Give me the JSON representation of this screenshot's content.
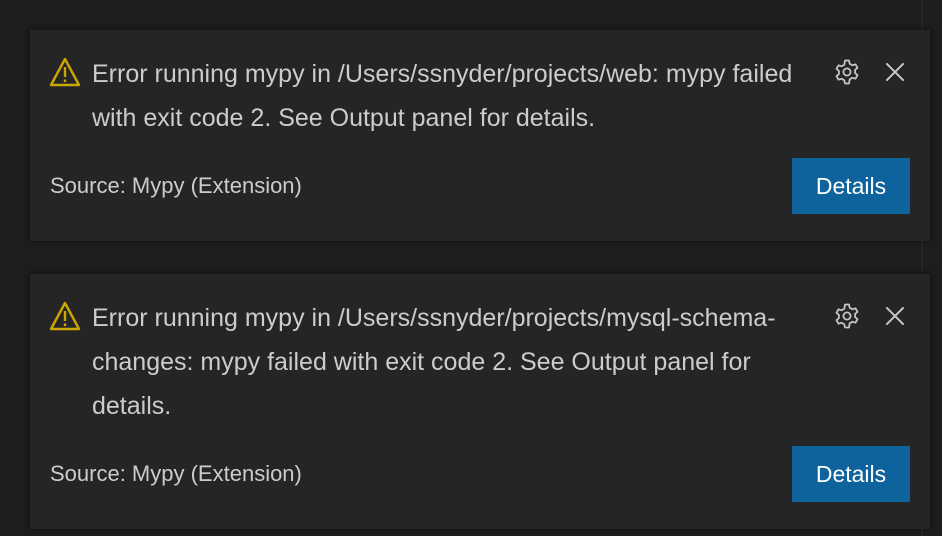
{
  "colors": {
    "warning": "#cca700",
    "button_bg": "#0e639c",
    "toast_bg": "#252526",
    "text": "#cccccc"
  },
  "notifications": [
    {
      "icon": "warning-icon",
      "message": "Error running mypy in /Users/ssnyder/projects/web: mypy failed with exit code 2. See Output panel for details.",
      "source": "Source: Mypy (Extension)",
      "button_label": "Details"
    },
    {
      "icon": "warning-icon",
      "message": "Error running mypy in /Users/ssnyder/projects/mysql-schema-changes: mypy failed with exit code 2. See Output panel for details.",
      "source": "Source: Mypy (Extension)",
      "button_label": "Details"
    }
  ]
}
